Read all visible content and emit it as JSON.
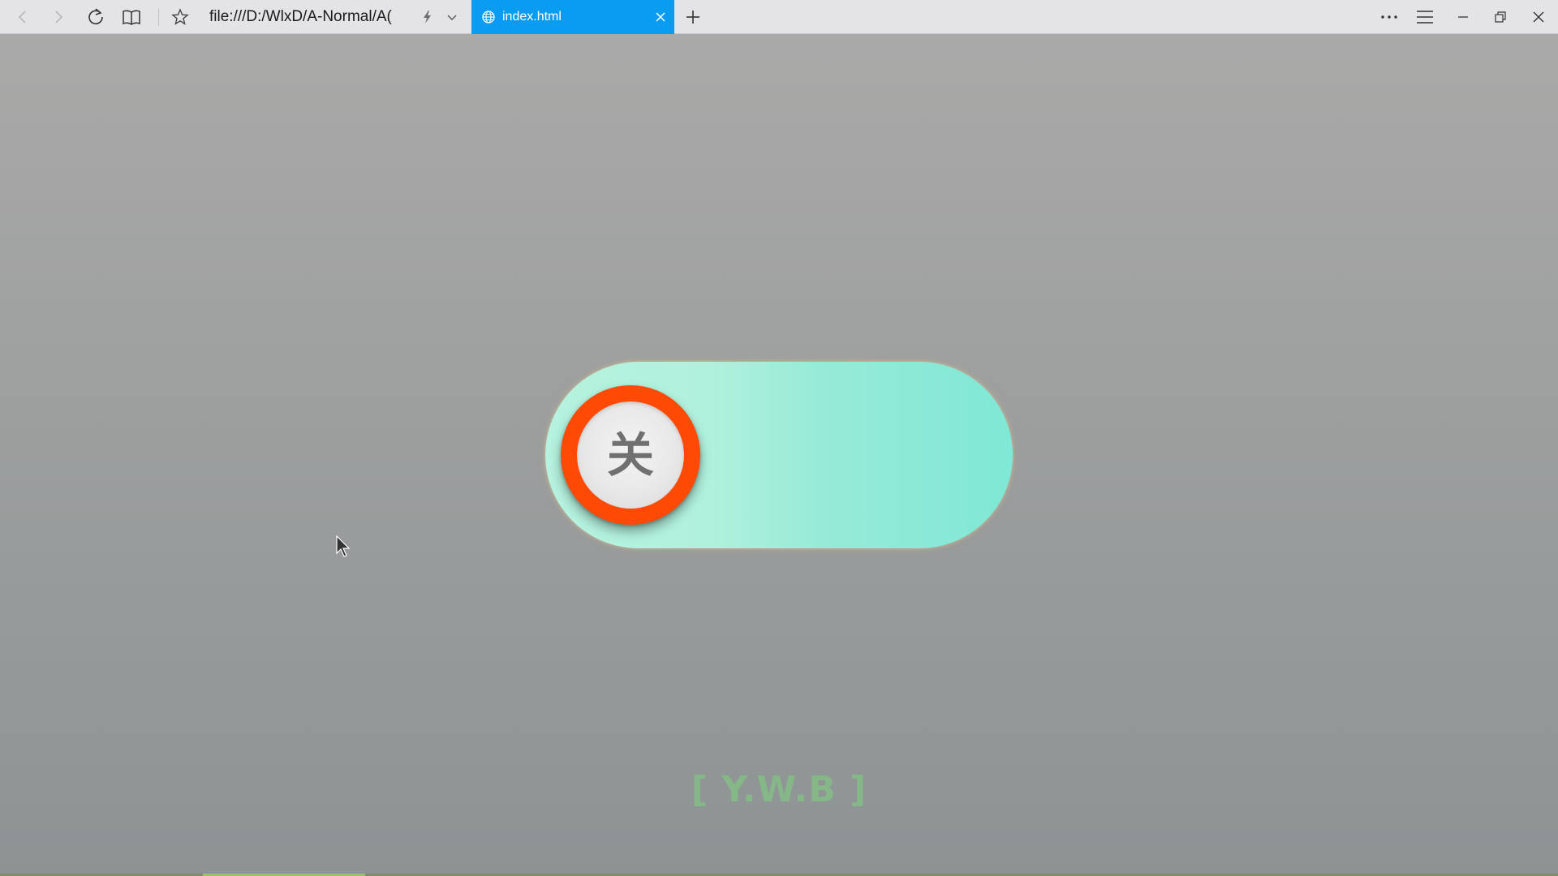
{
  "browser": {
    "address": "file:///D:/WlxD/A-Normal/A(",
    "tab_title": "index.html",
    "accent_color": "#0a9cf0",
    "icons": {
      "back": "back-arrow-icon",
      "forward": "forward-arrow-icon",
      "refresh": "refresh-icon",
      "reading_view": "book-icon",
      "favorite": "star-icon",
      "flash": "flash-icon",
      "dropdown": "chevron-down-icon",
      "tab_globe": "globe-icon",
      "tab_close": "close-icon",
      "new_tab": "plus-icon",
      "more": "more-icon",
      "hub": "hamburger-icon",
      "minimize": "minimize-icon",
      "restore": "restore-icon",
      "close": "close-icon"
    }
  },
  "page": {
    "toggle": {
      "label": "关",
      "state": "off",
      "track_color": "#b0f1dd",
      "knob_ring_color": "#ff4a06"
    },
    "watermark": "[ Y.W.B ]",
    "watermark_color": "#86b788"
  }
}
